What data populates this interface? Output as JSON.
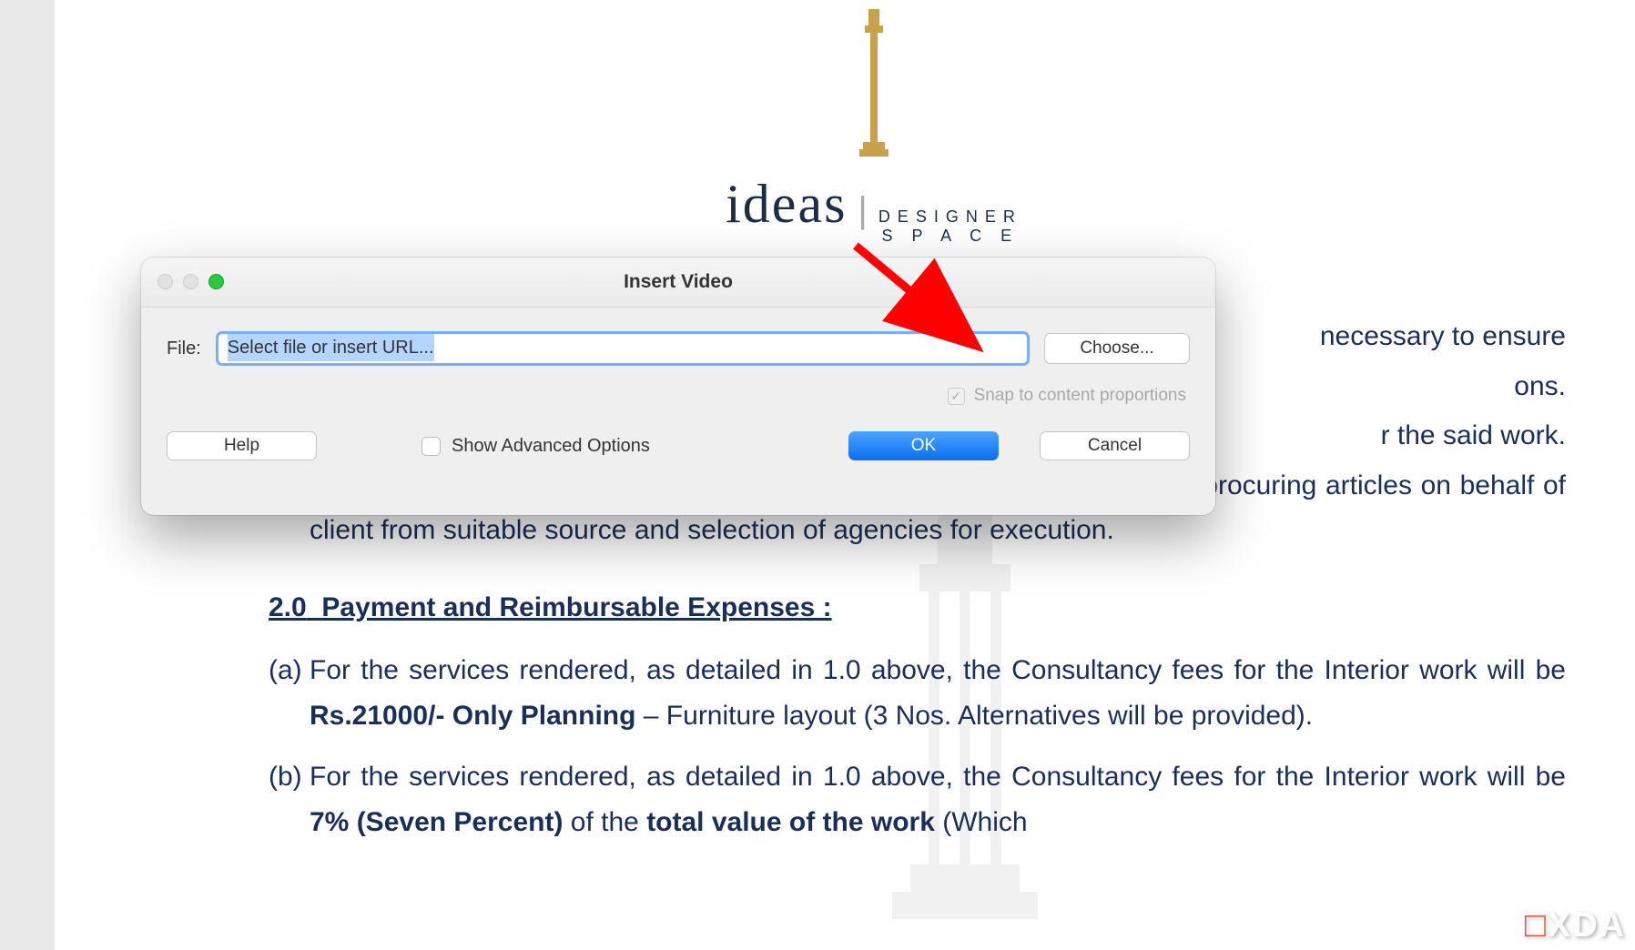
{
  "logo": {
    "main": "ideas",
    "sub1": "DESIGNER",
    "sub2": "S P A C E"
  },
  "document": {
    "para1_frag1": "necessary to ensure",
    "para1_frag2": "ons.",
    "para2_frag": "r the said work.",
    "para3_frag": ", lamps, accessories, paintings, murals, curtain, fabric, etc. Also assist in procuring articles on behalf of client from suitable source and selection of agencies for execution.",
    "section_num": "2.0",
    "section_title": "Payment and Reimbursable Expenses :",
    "item_a_letter": "(a)",
    "item_a_text_before": "For the services rendered, as detailed in 1.0 above, the Consultancy fees for the Interior work will be ",
    "item_a_bold": "Rs.21000/- Only Planning",
    "item_a_text_after": " – Furniture layout (3 Nos. Alternatives will be provided).",
    "item_b_letter": "(b)",
    "item_b_text_before": "For the services rendered, as detailed in 1.0 above, the Consultancy fees for the Interior work will be ",
    "item_b_bold1": "7% (Seven Percent)",
    "item_b_mid": " of the ",
    "item_b_bold2": "total value of the work",
    "item_b_after": " (Which"
  },
  "dialog": {
    "title": "Insert Video",
    "file_label": "File:",
    "file_placeholder": "Select file or insert URL...",
    "choose": "Choose...",
    "snap": "Snap to content proportions",
    "help": "Help",
    "advanced": "Show Advanced Options",
    "ok": "OK",
    "cancel": "Cancel"
  },
  "watermark": "XDA"
}
